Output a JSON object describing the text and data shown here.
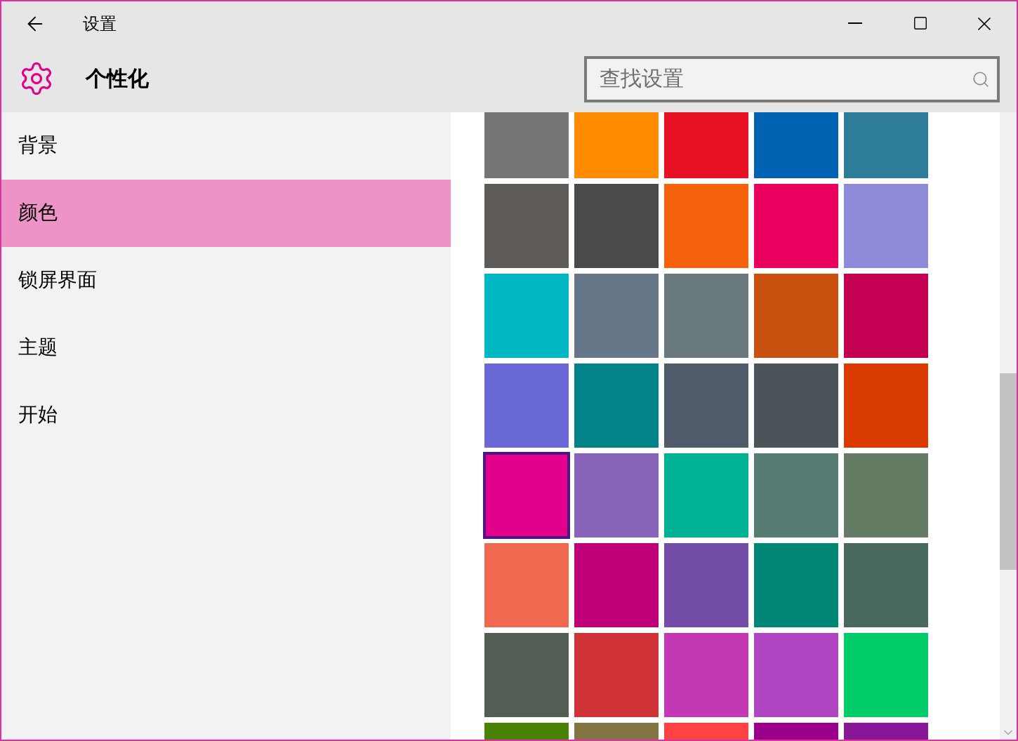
{
  "window": {
    "title": "设置"
  },
  "header": {
    "title": "个性化"
  },
  "search": {
    "placeholder": "查找设置"
  },
  "sidebar": {
    "items": [
      {
        "label": "背景",
        "selected": false
      },
      {
        "label": "颜色",
        "selected": true
      },
      {
        "label": "锁屏界面",
        "selected": false
      },
      {
        "label": "主题",
        "selected": false
      },
      {
        "label": "开始",
        "selected": false
      }
    ]
  },
  "swatches": [
    {
      "color": "#767676",
      "selected": false
    },
    {
      "color": "#ff8c00",
      "selected": false
    },
    {
      "color": "#e81123",
      "selected": false
    },
    {
      "color": "#0063b1",
      "selected": false
    },
    {
      "color": "#2d7d9a",
      "selected": false
    },
    {
      "color": "#5d5a58",
      "selected": false
    },
    {
      "color": "#4c4a48",
      "selected": false
    },
    {
      "color": "#f7630c",
      "selected": false
    },
    {
      "color": "#ea005e",
      "selected": false
    },
    {
      "color": "#8e8cd8",
      "selected": false
    },
    {
      "color": "#00b7c3",
      "selected": false
    },
    {
      "color": "#68768a",
      "selected": false
    },
    {
      "color": "#69797e",
      "selected": false
    },
    {
      "color": "#ca5010",
      "selected": false
    },
    {
      "color": "#c30052",
      "selected": false
    },
    {
      "color": "#6b69d6",
      "selected": false
    },
    {
      "color": "#038387",
      "selected": false
    },
    {
      "color": "#515c6b",
      "selected": false
    },
    {
      "color": "#4a5459",
      "selected": false
    },
    {
      "color": "#da3b01",
      "selected": false
    },
    {
      "color": "#e3008c",
      "selected": true
    },
    {
      "color": "#8764b8",
      "selected": false
    },
    {
      "color": "#00b294",
      "selected": false
    },
    {
      "color": "#567c73",
      "selected": false
    },
    {
      "color": "#647c64",
      "selected": false
    },
    {
      "color": "#ef6950",
      "selected": false
    },
    {
      "color": "#bf0077",
      "selected": false
    },
    {
      "color": "#744da9",
      "selected": false
    },
    {
      "color": "#018574",
      "selected": false
    },
    {
      "color": "#486860",
      "selected": false
    },
    {
      "color": "#525e54",
      "selected": false
    },
    {
      "color": "#d13438",
      "selected": false
    },
    {
      "color": "#c239b3",
      "selected": false
    },
    {
      "color": "#b146c2",
      "selected": false
    },
    {
      "color": "#00cc6a",
      "selected": false
    },
    {
      "color": "#498205",
      "selected": false
    },
    {
      "color": "#847545",
      "selected": false
    },
    {
      "color": "#ff4343",
      "selected": false
    },
    {
      "color": "#9a0089",
      "selected": false
    },
    {
      "color": "#881798",
      "selected": false
    }
  ]
}
